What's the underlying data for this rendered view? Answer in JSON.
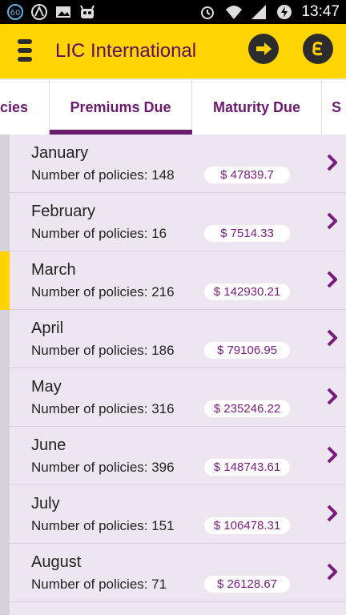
{
  "status": {
    "notif_badge": "60",
    "time": "13:47"
  },
  "app": {
    "title": "LIC International"
  },
  "tabs": [
    {
      "label": "cies"
    },
    {
      "label": "Premiums Due"
    },
    {
      "label": "Maturity Due"
    },
    {
      "label": "S"
    }
  ],
  "rows": [
    {
      "month": "January",
      "count": "Number of policies: 148",
      "amount": "$ 47839.7"
    },
    {
      "month": "February",
      "count": "Number of policies: 16",
      "amount": "$ 7514.33"
    },
    {
      "month": "March",
      "count": "Number of policies: 216",
      "amount": "$ 142930.21"
    },
    {
      "month": "April",
      "count": "Number of policies: 186",
      "amount": "$ 79106.95"
    },
    {
      "month": "May",
      "count": "Number of policies: 316",
      "amount": "$ 235246.22"
    },
    {
      "month": "June",
      "count": "Number of policies: 396",
      "amount": "$ 148743.61"
    },
    {
      "month": "July",
      "count": "Number of policies: 151",
      "amount": "$ 106478.31"
    },
    {
      "month": "August",
      "count": "Number of policies: 71",
      "amount": "$ 26128.67"
    }
  ],
  "colors": {
    "accent": "#ffd400",
    "brand_purple": "#6a1b6e"
  }
}
